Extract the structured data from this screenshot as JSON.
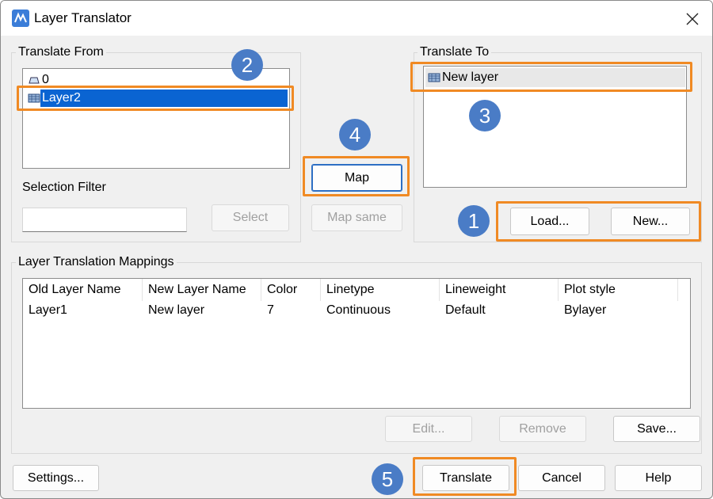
{
  "window": {
    "title": "Layer Translator"
  },
  "translate_from": {
    "label": "Translate From",
    "items": [
      "0",
      "Layer2"
    ],
    "selected": "Layer2",
    "selection_filter_label": "Selection Filter",
    "selection_filter_value": "",
    "select_button": "Select"
  },
  "middle": {
    "map_button": "Map",
    "map_same_button": "Map same"
  },
  "translate_to": {
    "label": "Translate To",
    "items": [
      "New layer"
    ],
    "load_button": "Load...",
    "new_button": "New..."
  },
  "mappings": {
    "label": "Layer Translation Mappings",
    "columns": [
      "Old Layer Name",
      "New Layer Name",
      "Color",
      "Linetype",
      "Lineweight",
      "Plot style"
    ],
    "rows": [
      [
        "Layer1",
        "New layer",
        "7",
        "Continuous",
        "Default",
        "Bylayer"
      ]
    ],
    "edit_button": "Edit...",
    "remove_button": "Remove",
    "save_button": "Save..."
  },
  "footer": {
    "settings_button": "Settings...",
    "translate_button": "Translate",
    "cancel_button": "Cancel",
    "help_button": "Help"
  },
  "annotations": {
    "badges": [
      "1",
      "2",
      "3",
      "4",
      "5"
    ],
    "highlight_color": "#f08a24",
    "badge_color": "#4a7cc6"
  },
  "colors": {
    "selection": "#0a64d2",
    "default_button_border": "#2d6fc4"
  }
}
